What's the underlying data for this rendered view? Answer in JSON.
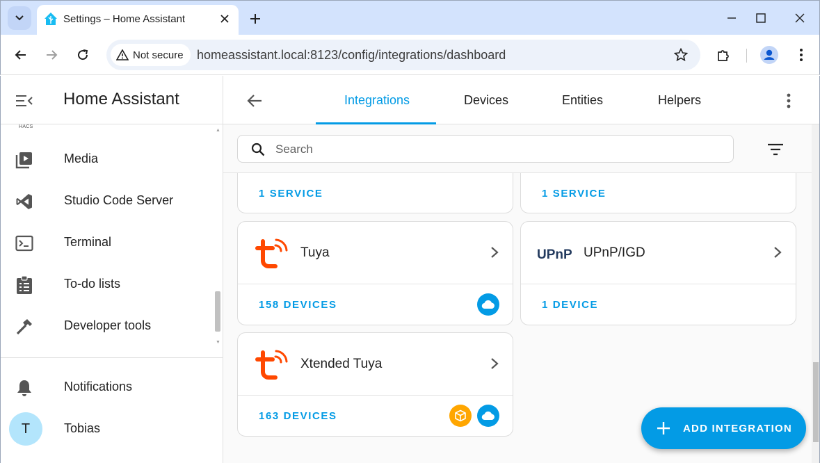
{
  "browser": {
    "tab_title": "Settings – Home Assistant",
    "security_label": "Not secure",
    "url": "homeassistant.local:8123/config/integrations/dashboard"
  },
  "sidebar": {
    "title": "Home Assistant",
    "hacs_label": "HACS",
    "items": [
      {
        "label": "Media",
        "icon": "media-icon"
      },
      {
        "label": "Studio Code Server",
        "icon": "vscode-icon"
      },
      {
        "label": "Terminal",
        "icon": "terminal-icon"
      },
      {
        "label": "To-do lists",
        "icon": "clipboard-list-icon"
      },
      {
        "label": "Developer tools",
        "icon": "hammer-icon"
      }
    ],
    "notifications_label": "Notifications",
    "user": {
      "initial": "T",
      "name": "Tobias"
    }
  },
  "main": {
    "tabs": [
      {
        "label": "Integrations",
        "active": true
      },
      {
        "label": "Devices",
        "active": false
      },
      {
        "label": "Entities",
        "active": false
      },
      {
        "label": "Helpers",
        "active": false
      }
    ],
    "search_placeholder": "Search",
    "partial_cards": [
      {
        "footer": "1 SERVICE"
      },
      {
        "footer": "1 SERVICE"
      }
    ],
    "cards": [
      {
        "name": "Tuya",
        "footer": "158 DEVICES",
        "logo": "tuya-logo",
        "badges": [
          "cloud"
        ]
      },
      {
        "name": "UPnP/IGD",
        "footer": "1 DEVICE",
        "logo": "upnp-logo",
        "logo_text": "UPnP",
        "badges": []
      },
      {
        "name": "Xtended Tuya",
        "footer": "163 DEVICES",
        "logo": "tuya-logo",
        "badges": [
          "custom",
          "cloud"
        ]
      }
    ],
    "add_button_label": "ADD INTEGRATION"
  },
  "colors": {
    "accent": "#039be5",
    "tuya": "#ff4800",
    "custom_badge": "#ffa600",
    "chrome_tabstrip": "#d3e3fd"
  }
}
